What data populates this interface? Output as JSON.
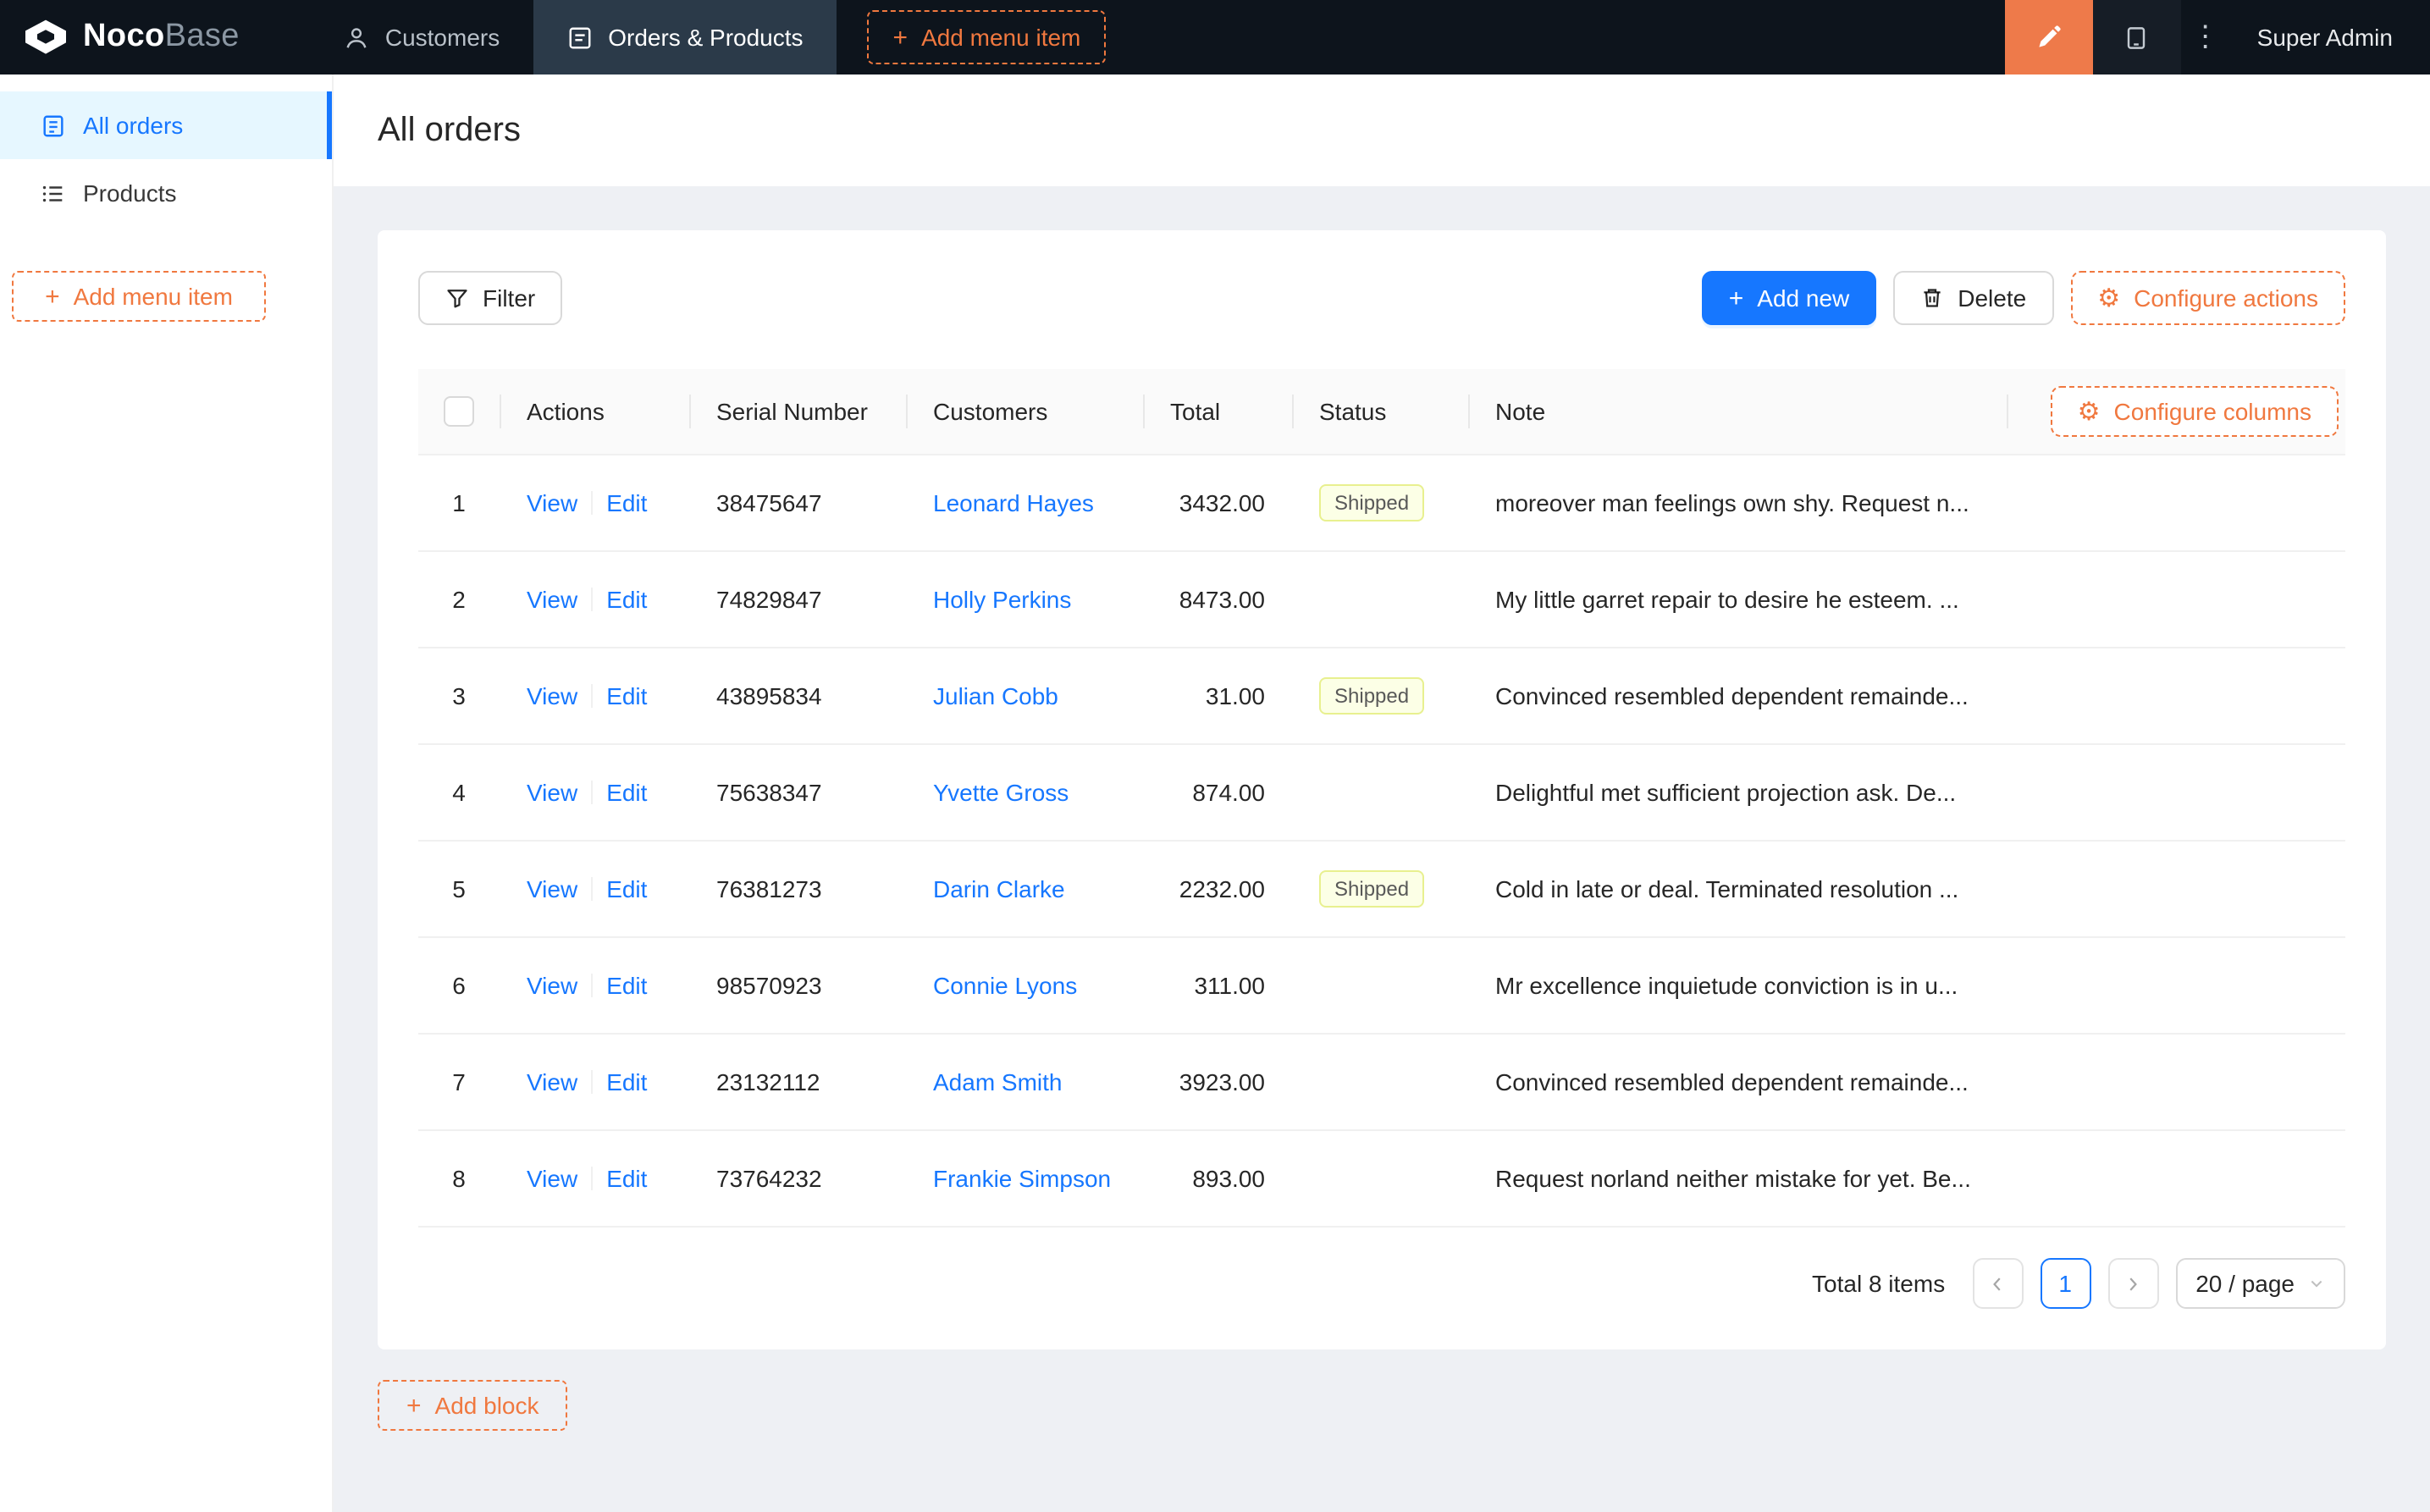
{
  "colors": {
    "topbar_bg": "#0d141c",
    "topbar_active_tab": "#2b3a49",
    "accent_orange": "#f0783f",
    "editor_button_orange": "#ee7a4a",
    "primary_blue": "#1677ff",
    "sidebar_active_bg": "#e6f7ff",
    "content_bg": "#eef0f4",
    "tag_bg": "#fcffe6",
    "tag_border": "#e8f08f"
  },
  "icons": {
    "plus": "+",
    "gear": "⚙",
    "ellipsis": "⋮"
  },
  "brand": {
    "bold": "Noco",
    "light": "Base"
  },
  "topbar": {
    "nav": [
      {
        "label": "Customers"
      },
      {
        "label": "Orders & Products"
      }
    ],
    "add_menu_item": "Add menu item",
    "user": "Super Admin"
  },
  "sidebar": {
    "items": [
      {
        "label": "All orders"
      },
      {
        "label": "Products"
      }
    ],
    "add_menu_item": "Add menu item"
  },
  "page": {
    "title": "All orders"
  },
  "toolbar": {
    "filter": "Filter",
    "add_new": "Add new",
    "delete": "Delete",
    "configure_actions": "Configure actions"
  },
  "table": {
    "configure_columns": "Configure columns",
    "headers": [
      "Actions",
      "Serial Number",
      "Customers",
      "Total",
      "Status",
      "Note"
    ],
    "view_label": "View",
    "edit_label": "Edit",
    "rows": [
      {
        "index": "1",
        "serial": "38475647",
        "customer": "Leonard Hayes",
        "total": "3432.00",
        "status": "Shipped",
        "note": "moreover man feelings own shy. Request n..."
      },
      {
        "index": "2",
        "serial": "74829847",
        "customer": "Holly Perkins",
        "total": "8473.00",
        "status": "",
        "note": "My little garret repair to desire he esteem. ..."
      },
      {
        "index": "3",
        "serial": "43895834",
        "customer": "Julian Cobb",
        "total": "31.00",
        "status": "Shipped",
        "note": "Convinced resembled dependent remainde..."
      },
      {
        "index": "4",
        "serial": "75638347",
        "customer": "Yvette Gross",
        "total": "874.00",
        "status": "",
        "note": "Delightful met sufficient projection ask. De..."
      },
      {
        "index": "5",
        "serial": "76381273",
        "customer": "Darin Clarke",
        "total": "2232.00",
        "status": "Shipped",
        "note": "Cold in late or deal. Terminated resolution ..."
      },
      {
        "index": "6",
        "serial": "98570923",
        "customer": "Connie Lyons",
        "total": "311.00",
        "status": "",
        "note": "Mr excellence inquietude conviction is in u..."
      },
      {
        "index": "7",
        "serial": "23132112",
        "customer": "Adam Smith",
        "total": "3923.00",
        "status": "",
        "note": "Convinced resembled dependent remainde..."
      },
      {
        "index": "8",
        "serial": "73764232",
        "customer": "Frankie Simpson",
        "total": "893.00",
        "status": "",
        "note": "Request norland neither mistake for yet. Be..."
      }
    ]
  },
  "pagination": {
    "total_label": "Total 8 items",
    "current_page": "1",
    "page_size": "20 / page"
  },
  "footer": {
    "add_block": "Add block"
  }
}
